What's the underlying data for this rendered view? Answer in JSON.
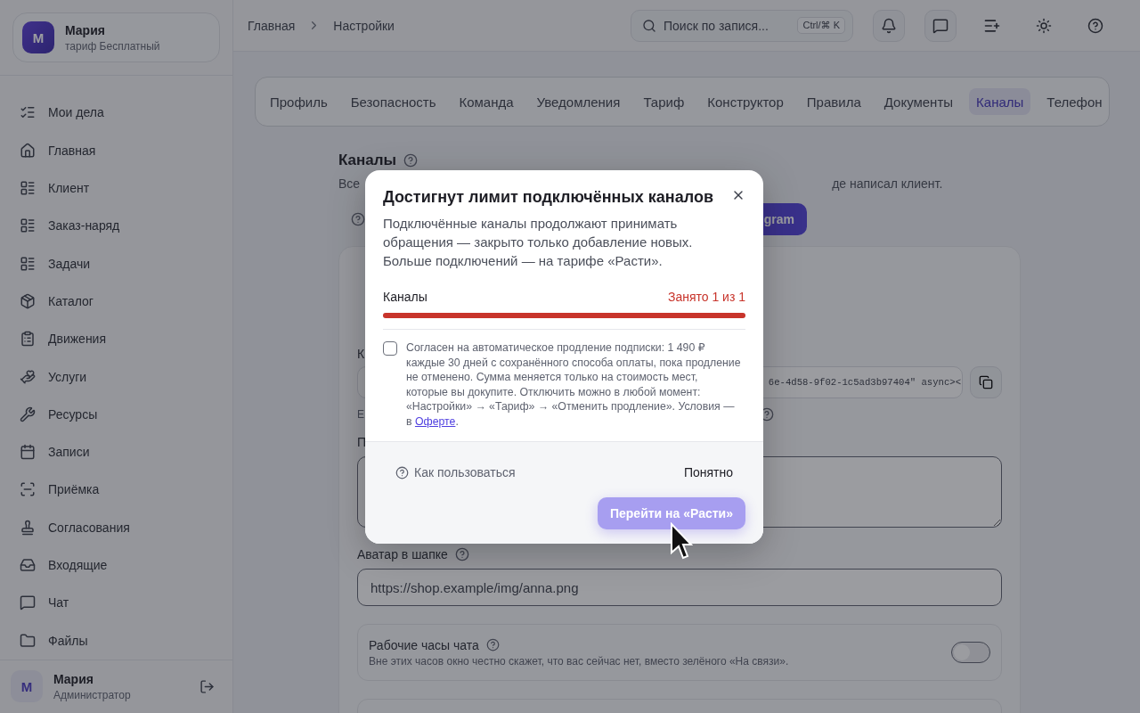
{
  "sidebar": {
    "account": {
      "avatar": "М",
      "name": "Мария",
      "plan": "тариф Бесплатный"
    },
    "items": [
      "Мои дела",
      "Главная",
      "Клиент",
      "Заказ-наряд",
      "Задачи",
      "Каталог",
      "Движения",
      "Услуги",
      "Ресурсы",
      "Записи",
      "Приёмка",
      "Согласования",
      "Входящие",
      "Чат",
      "Файлы"
    ],
    "user": {
      "avatar": "М",
      "name": "Мария",
      "role": "Администратор"
    }
  },
  "header": {
    "breadcrumbs": [
      "Главная",
      "Настройки"
    ],
    "search": {
      "placeholder": "Поиск по запися...",
      "shortcut": "Ctrl/⌘ K"
    }
  },
  "tabs": [
    {
      "label": "Профиль",
      "selected": false
    },
    {
      "label": "Безопасность",
      "selected": false
    },
    {
      "label": "Команда",
      "selected": false
    },
    {
      "label": "Уведомления",
      "selected": false
    },
    {
      "label": "Тариф",
      "selected": false
    },
    {
      "label": "Конструктор",
      "selected": false
    },
    {
      "label": "Правила",
      "selected": false
    },
    {
      "label": "Документы",
      "selected": false
    },
    {
      "label": "Каналы",
      "selected": true
    },
    {
      "label": "Телефон",
      "selected": false
    }
  ],
  "section": {
    "title": "Каналы",
    "description_start": "Все",
    "description_end": "де написал клиент.",
    "button": "gram",
    "code_label": "К",
    "code_value": "6e-4d58-9f02-1c5ad3b97404\" async><",
    "hint": "Е",
    "message_label": "П",
    "avatar_label": "Аватар в шапке",
    "avatar_value": "https://shop.example/img/anna.png",
    "hours": {
      "title": "Рабочие часы чата",
      "description": "Вне этих часов окно честно скажет, что вас сейчас нет, вместо зелёного «На связи».",
      "on": false
    }
  },
  "dialog": {
    "title": "Достигнут лимит подключённых каналов",
    "text": "Подключённые каналы продолжают принимать обращения — закрыто только добавление новых. Больше подключений — на тарифе «Расти».",
    "meter": {
      "label": "Каналы",
      "reading": "Занято 1 из 1",
      "level": 1
    },
    "consent": {
      "checked": false,
      "text": "Согласен на автоматическое продление подписки: 1 490 ₽ каждые 30 дней с сохранённого способа оплаты, пока продление не отменено. Сумма меняется только на стоимость мест, которые вы докупите. Отключить можно в любой момент: «Настройки» → «Тариф» → «Отменить продление». Условия — в ",
      "link": "Оферте",
      "text_end": "."
    },
    "help": "Как пользоваться",
    "ok": "Понятно",
    "primary": {
      "label": "Перейти на «Расти»",
      "disabled": true
    }
  }
}
